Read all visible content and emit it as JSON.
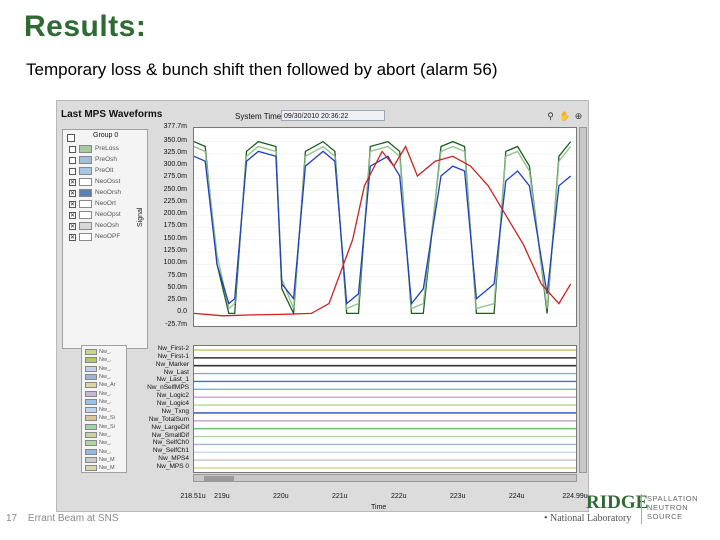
{
  "slide": {
    "title": "Results:",
    "subtitle": "Temporary loss & bunch shift then followed by abort (alarm 56)"
  },
  "window": {
    "title": "Last MPS Waveforms",
    "system_time_label": "System Time",
    "system_time_value": "09/30/2010 20:36:22",
    "icons": [
      "search-icon",
      "hand-icon",
      "zoom-icon"
    ]
  },
  "legend_group": {
    "header": "Group 0",
    "items": [
      {
        "label": "PreLoss",
        "color": "#a6c9a0",
        "checked": false
      },
      {
        "label": "PreOsh",
        "color": "#9fbfd8",
        "checked": false
      },
      {
        "label": "PreOlt",
        "color": "#a9c6e2",
        "checked": false
      },
      {
        "label": "NeoOsst",
        "color": "#ffffff",
        "checked": true
      },
      {
        "label": "NeoOrsh",
        "color": "#5b7fb5",
        "checked": true
      },
      {
        "label": "NeoOrt",
        "color": "#ffffff",
        "checked": true
      },
      {
        "label": "NeoOpst",
        "color": "#ffffff",
        "checked": true
      },
      {
        "label": "NeoOsh",
        "color": "#d8d8d8",
        "checked": true
      },
      {
        "label": "NeoOPF",
        "color": "#ffffff",
        "checked": true
      }
    ]
  },
  "lower_legend": {
    "items": [
      {
        "label": "Nw_.",
        "color": "#c9d97a"
      },
      {
        "label": "Nw_.",
        "color": "#b7c46c"
      },
      {
        "label": "Nw_.",
        "color": "#c1d2ea"
      },
      {
        "label": "Nw_.",
        "color": "#a4b3d1"
      },
      {
        "label": "Nw_Ar",
        "color": "#d6d6a6"
      },
      {
        "label": "Nw_.",
        "color": "#c9b6d4"
      },
      {
        "label": "Nw_.",
        "color": "#9cc0e6"
      },
      {
        "label": "Nw_.",
        "color": "#bcd4ee"
      },
      {
        "label": "Nw_Si",
        "color": "#d9c79a"
      },
      {
        "label": "Nw_Si",
        "color": "#a2d0a8"
      },
      {
        "label": "Nw_.",
        "color": "#c7d39e"
      },
      {
        "label": "Nw_.",
        "color": "#aed4a4"
      },
      {
        "label": "Nw_.",
        "color": "#97b8de"
      },
      {
        "label": "Nw_M",
        "color": "#c9c9c9"
      },
      {
        "label": "Nw_M",
        "color": "#d6d6b0"
      }
    ]
  },
  "chart_data": {
    "type": "line",
    "title": "",
    "xlabel": "Time",
    "ylabel": "Signal",
    "y_ticks": [
      "377.7m",
      "350.0m",
      "325.0m",
      "300.0m",
      "275.0m",
      "250.0m",
      "225.0m",
      "200.0m",
      "175.0m",
      "150.0m",
      "125.0m",
      "100.0m",
      "75.0m",
      "50.0m",
      "25.0m",
      "0.0",
      "-25.7m"
    ],
    "ylim": [
      -0.0257,
      0.3777
    ],
    "x_ticks": [
      "218.51u",
      "219u",
      "220u",
      "221u",
      "222u",
      "223u",
      "224u",
      "224.99u"
    ],
    "xlim": [
      0.00021851,
      0.00022499
    ],
    "series": [
      {
        "color": "#1b5e20",
        "x": [
          0.00021851,
          0.0002187,
          0.0002189,
          0.0002191,
          0.0002192,
          0.0002194,
          0.0002196,
          0.0002199,
          0.00022,
          0.0002202,
          0.0002204,
          0.0002207,
          0.0002209,
          0.0002211,
          0.0002213,
          0.0002215,
          0.0002218,
          0.000222,
          0.0002222,
          0.0002224,
          0.0002227,
          0.0002229,
          0.0002231,
          0.0002233,
          0.0002236,
          0.0002238,
          0.000224,
          0.0002242,
          0.0002245,
          0.0002247,
          0.0002249
        ],
        "y": [
          0.35,
          0.34,
          0.1,
          0.0,
          0.0,
          0.33,
          0.35,
          0.34,
          0.05,
          0.0,
          0.33,
          0.35,
          0.33,
          0.0,
          0.0,
          0.34,
          0.35,
          0.33,
          0.0,
          0.0,
          0.34,
          0.35,
          0.34,
          0.0,
          0.0,
          0.33,
          0.34,
          0.3,
          0.0,
          0.32,
          0.35
        ]
      },
      {
        "color": "#8fbf8a",
        "x": [
          0.00021851,
          0.0002187,
          0.0002189,
          0.0002191,
          0.0002192,
          0.0002194,
          0.0002196,
          0.0002199,
          0.00022,
          0.0002202,
          0.0002204,
          0.0002207,
          0.0002209,
          0.0002211,
          0.0002213,
          0.0002215,
          0.0002218,
          0.000222,
          0.0002222,
          0.0002224,
          0.0002227,
          0.0002229,
          0.0002231,
          0.0002233,
          0.0002236,
          0.0002238,
          0.000224,
          0.0002242,
          0.0002245,
          0.0002247,
          0.0002249
        ],
        "y": [
          0.34,
          0.33,
          0.12,
          0.01,
          0.02,
          0.32,
          0.34,
          0.33,
          0.07,
          0.01,
          0.32,
          0.34,
          0.32,
          0.01,
          0.02,
          0.33,
          0.34,
          0.32,
          0.01,
          0.02,
          0.33,
          0.34,
          0.33,
          0.01,
          0.02,
          0.32,
          0.33,
          0.29,
          0.01,
          0.31,
          0.34
        ]
      },
      {
        "color": "#1f3fbf",
        "x": [
          0.00021851,
          0.0002187,
          0.0002189,
          0.0002191,
          0.0002192,
          0.0002194,
          0.0002196,
          0.0002199,
          0.00022,
          0.0002202,
          0.0002204,
          0.0002207,
          0.0002209,
          0.0002211,
          0.0002213,
          0.0002215,
          0.0002218,
          0.000222,
          0.0002222,
          0.0002224,
          0.0002227,
          0.0002229,
          0.0002231,
          0.0002233,
          0.0002236,
          0.0002238,
          0.000224,
          0.0002242,
          0.0002245,
          0.0002247,
          0.0002249
        ],
        "y": [
          0.32,
          0.31,
          0.1,
          0.02,
          0.03,
          0.31,
          0.33,
          0.32,
          0.06,
          0.03,
          0.3,
          0.33,
          0.31,
          0.02,
          0.04,
          0.3,
          0.32,
          0.28,
          0.02,
          0.05,
          0.28,
          0.3,
          0.29,
          0.03,
          0.06,
          0.27,
          0.29,
          0.26,
          0.04,
          0.26,
          0.28
        ]
      },
      {
        "color": "#cc2222",
        "x": [
          0.00021851,
          0.000219,
          0.0002195,
          0.00022,
          0.0002205,
          0.0002208,
          0.0002212,
          0.0002214,
          0.0002217,
          0.0002219,
          0.0002221,
          0.0002223,
          0.0002226,
          0.0002229,
          0.0002232,
          0.0002235,
          0.0002238,
          0.0002241,
          0.0002244,
          0.0002247,
          0.0002249
        ],
        "y": [
          0.0,
          -0.005,
          -0.003,
          -0.002,
          0.0,
          0.02,
          0.15,
          0.26,
          0.33,
          0.3,
          0.34,
          0.28,
          0.31,
          0.32,
          0.3,
          0.26,
          0.2,
          0.14,
          0.06,
          0.02,
          0.06
        ]
      }
    ]
  },
  "digital": {
    "labels": [
      "Nw_First-2",
      "Nw_First-1",
      "Nw_Marker",
      "Nw_Last",
      "Nw_Last_1",
      "Nw_nSelfMPS",
      "Nw_Logic2",
      "Nw_Logic4",
      "Nw_Txng",
      "Nw_TotalSum",
      "Nw_LargeDif",
      "Nw_SmallDif",
      "Nw_SelfCh0",
      "Nw_SelfCh1",
      "Nw_MPS4",
      "Nw_MPS 0"
    ],
    "colors": [
      "#c9c96a",
      "#333333",
      "#333333",
      "#6fb2e6",
      "#4a68d8",
      "#6fb2e6",
      "#c4a3d8",
      "#b7d88f",
      "#2a45c8",
      "#c8a0b8",
      "#6fc070",
      "#a8d89a",
      "#9fb8e0",
      "#c8d8f0",
      "#c8c8c8",
      "#d8d8a0"
    ]
  },
  "footer": {
    "page": "17",
    "text": "Errant Beam at SNS",
    "logo_main": "RIDGE",
    "logo_sub": "National Laboratory",
    "logo_right_1": "SPALLATION",
    "logo_right_2": "NEUTRON",
    "logo_right_3": "SOURCE"
  }
}
